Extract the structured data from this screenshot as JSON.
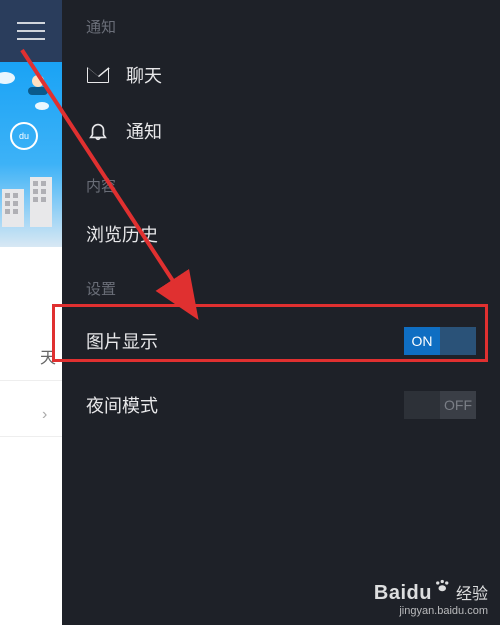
{
  "sections": {
    "notifications_label": "通知",
    "content_label": "内容",
    "settings_label": "设置"
  },
  "menu": {
    "chat": "聊天",
    "notice": "通知",
    "history": "浏览历史"
  },
  "settings": {
    "image_display": {
      "label": "图片显示",
      "state": "ON"
    },
    "night_mode": {
      "label": "夜间模式",
      "state": "OFF"
    }
  },
  "left": {
    "text_fragment": "天",
    "chevron": "›"
  },
  "watermark": {
    "brand": "Baidu",
    "cn": "经验",
    "url": "jingyan.baidu.com"
  }
}
